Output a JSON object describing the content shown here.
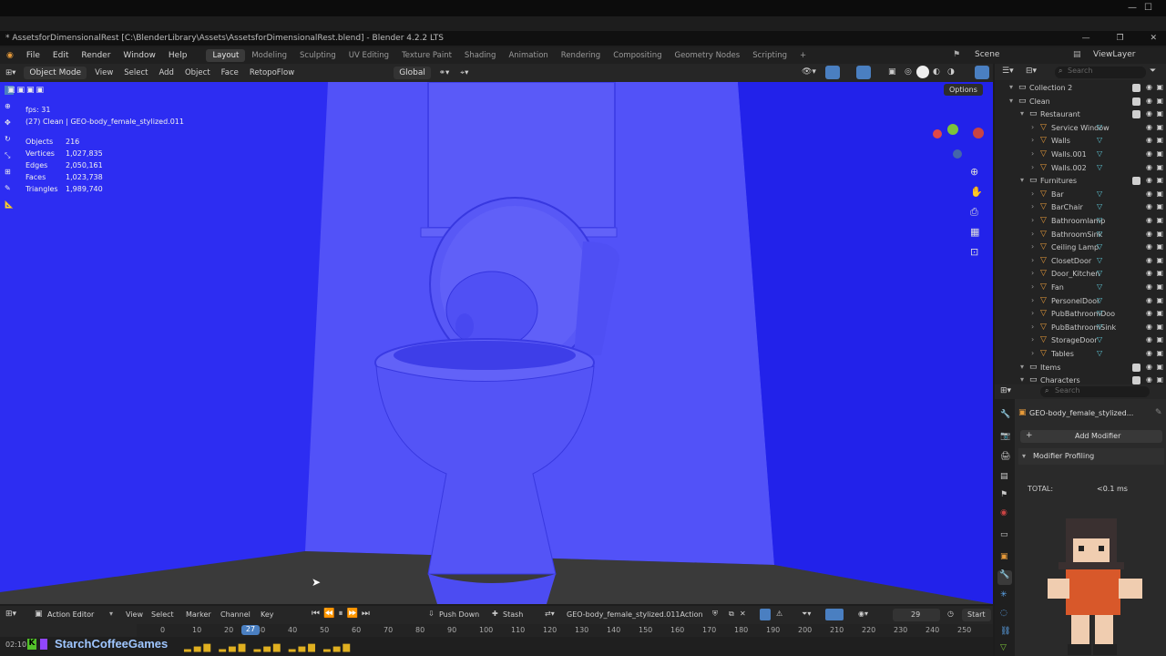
{
  "title_bar": {
    "text": "* AssetsforDimensionalRest [C:\\BlenderLibrary\\Assets\\AssetsforDimensionalRest.blend] - Blender 4.2.2 LTS"
  },
  "menu": [
    "File",
    "Edit",
    "Render",
    "Window",
    "Help"
  ],
  "workspaces": [
    "Layout",
    "Modeling",
    "Sculpting",
    "UV Editing",
    "Texture Paint",
    "Shading",
    "Animation",
    "Rendering",
    "Compositing",
    "Geometry Nodes",
    "Scripting",
    "+"
  ],
  "active_workspace": "Layout",
  "scene": "Scene",
  "view_layer": "ViewLayer",
  "viewport_header": {
    "mode": "Object Mode",
    "items": [
      "View",
      "Select",
      "Add",
      "Object",
      "Face"
    ],
    "addon": "RetopoFlow",
    "transform": "Global",
    "options": "Options"
  },
  "stats": {
    "fps": "fps: 31",
    "active": "(27) Clean | GEO-body_female_stylized.011",
    "objects_label": "Objects",
    "objects": "216",
    "vertices_label": "Vertices",
    "vertices": "1,027,835",
    "edges_label": "Edges",
    "edges": "2,050,161",
    "faces_label": "Faces",
    "faces": "1,023,738",
    "triangles_label": "Triangles",
    "triangles": "1,989,740"
  },
  "outliner": {
    "search_placeholder": "Search",
    "rows": [
      {
        "label": "Collection 2",
        "depth": 1
      },
      {
        "label": "Clean",
        "depth": 1
      },
      {
        "label": "Restaurant",
        "depth": 2
      },
      {
        "label": "Service Window",
        "depth": 3
      },
      {
        "label": "Walls",
        "depth": 3
      },
      {
        "label": "Walls.001",
        "depth": 3
      },
      {
        "label": "Walls.002",
        "depth": 3
      },
      {
        "label": "Furnitures",
        "depth": 2
      },
      {
        "label": "Bar",
        "depth": 3
      },
      {
        "label": "BarChair",
        "depth": 3
      },
      {
        "label": "Bathroomlamp",
        "depth": 3
      },
      {
        "label": "BathroomSink",
        "depth": 3
      },
      {
        "label": "Ceiling Lamp",
        "depth": 3
      },
      {
        "label": "ClosetDoor",
        "depth": 3
      },
      {
        "label": "Door_Kitchen",
        "depth": 3
      },
      {
        "label": "Fan",
        "depth": 3
      },
      {
        "label": "PersonelDoor",
        "depth": 3
      },
      {
        "label": "PubBathroomDoo",
        "depth": 3
      },
      {
        "label": "PubBathroomSink",
        "depth": 3
      },
      {
        "label": "StorageDoor",
        "depth": 3
      },
      {
        "label": "Tables",
        "depth": 3
      },
      {
        "label": "Items",
        "depth": 2
      },
      {
        "label": "Characters",
        "depth": 2
      }
    ]
  },
  "properties": {
    "search_placeholder": "Search",
    "object_name": "GEO-body_female_stylized...",
    "add_modifier": "Add Modifier",
    "panel": "Modifier Profiling",
    "total_label": "TOTAL:",
    "total_value": "<0.1 ms"
  },
  "timeline": {
    "editor": "Action Editor",
    "menus": [
      "View",
      "Select",
      "Marker",
      "Channel",
      "Key"
    ],
    "push_down": "Push Down",
    "stash": "Stash",
    "action": "GEO-body_female_stylized.011Action",
    "frame": "29",
    "start": "Start",
    "current_frame": "27",
    "ticks": [
      "0",
      "10",
      "20",
      "30",
      "40",
      "50",
      "60",
      "70",
      "80",
      "90",
      "100",
      "110",
      "120",
      "130",
      "140",
      "150",
      "160",
      "170",
      "180",
      "190",
      "200",
      "210",
      "220",
      "230",
      "240",
      "250"
    ]
  },
  "stream": {
    "time": "02:10",
    "channel": "StarchCoffeeGames",
    "search": "Search"
  },
  "colors": {
    "viewport_blue": "#2b2bf0",
    "accent": "#4a7fc1",
    "object_orange": "#e69a3a"
  }
}
